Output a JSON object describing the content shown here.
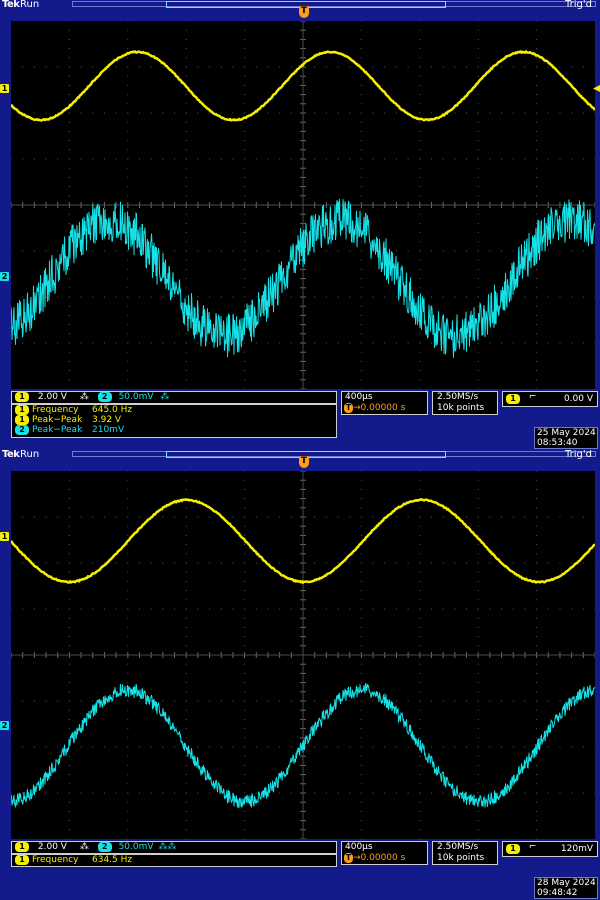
{
  "screenshots": [
    {
      "brand": "Tek",
      "status": "Run",
      "trigger_status": "Trig'd",
      "trigger_marker": "T",
      "ch1_marker": "1",
      "ch2_marker": "2",
      "ch1_color": "#f4f000",
      "ch2_color": "#16e1e6",
      "ch1_scale": "2.00 V",
      "ch1_coupling": "⁂",
      "ch2_scale": "50.0mV",
      "ch2_coupling": "⁂",
      "measurements": [
        {
          "channel": "1",
          "label": "Frequency",
          "value": "645.0 Hz"
        },
        {
          "channel": "1",
          "label": "Peak−Peak",
          "value": "3.92 V"
        },
        {
          "channel": "2",
          "label": "Peak−Peak",
          "value": "210mV"
        }
      ],
      "timebase": "400µs",
      "trigger_pos": "→0.00000 s",
      "sample_rate": "2.50MS/s",
      "record_length": "10k points",
      "trigger_channel": "1",
      "trigger_slope": "⌐",
      "trigger_level": "0.00 V",
      "date": "25 May 2024",
      "time": "08:53:40",
      "ch1_waveform": {
        "freq_hz": 645.0,
        "peak_to_peak_v": 3.92
      },
      "ch2_waveform": {
        "freq_hz": 645.0,
        "peak_to_peak_v": 0.21,
        "noise": "heavy"
      }
    },
    {
      "brand": "Tek",
      "status": "Run",
      "trigger_status": "Trig'd",
      "trigger_marker": "T",
      "ch1_marker": "1",
      "ch2_marker": "2",
      "ch1_color": "#f4f000",
      "ch2_color": "#16e1e6",
      "ch1_scale": "2.00 V",
      "ch1_coupling": "⁂",
      "ch2_scale": "50.0mV",
      "ch2_coupling": "⁂⁂",
      "measurements": [
        {
          "channel": "1",
          "label": "Frequency",
          "value": "634.5 Hz"
        }
      ],
      "timebase": "400µs",
      "trigger_pos": "→0.00000 s",
      "sample_rate": "2.50MS/s",
      "record_length": "10k points",
      "trigger_channel": "1",
      "trigger_slope": "⌐",
      "trigger_level": "120mV",
      "date": "28 May 2024",
      "time": "09:48:42",
      "ch1_waveform": {
        "freq_hz": 634.5
      },
      "ch2_waveform": {
        "freq_hz": 634.5,
        "noise": "light"
      }
    }
  ]
}
